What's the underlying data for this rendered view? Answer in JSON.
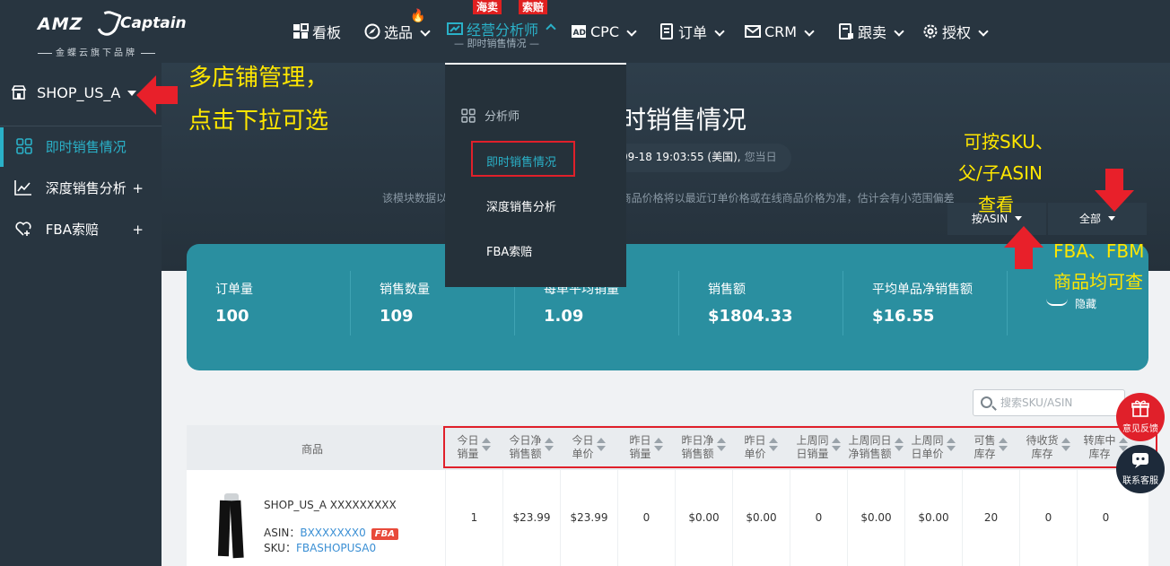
{
  "brand": {
    "logo_left": "AMZ",
    "logo_right": "Captain",
    "tagline": "金蝶云旗下品牌"
  },
  "nav": {
    "items": [
      {
        "label": "看板"
      },
      {
        "label": "选品"
      },
      {
        "label": "经营分析师",
        "sub": "— 即时销售情况 —"
      },
      {
        "label": "CPC"
      },
      {
        "label": "订单"
      },
      {
        "label": "CRM"
      },
      {
        "label": "跟卖"
      },
      {
        "label": "授权"
      }
    ],
    "tag_haimai": "海卖",
    "tag_suopei": "索赔"
  },
  "sidebar": {
    "shop": "SHOP_US_A",
    "items": [
      {
        "label": "即时销售情况"
      },
      {
        "label": "深度销售分析",
        "plus": "+"
      },
      {
        "label": "FBA索赔",
        "plus": "+"
      }
    ]
  },
  "dropdown": {
    "header": "分析师",
    "items": [
      {
        "label": "即时销售情况"
      },
      {
        "label": "深度销售分析"
      },
      {
        "label": "FBA索赔"
      }
    ]
  },
  "hero": {
    "title": "时销售情况",
    "time": "09-18 19:03:55 (美国),",
    "time_suffix": "您当日",
    "note_left": "该模块数据以",
    "note_right": "商品价格将以最近订单价格或在线商品价格为准，估计会有小范围偏差",
    "filter_asin": "按ASIN",
    "filter_all": "全部"
  },
  "stats": [
    {
      "label": "订单量",
      "value": "100"
    },
    {
      "label": "销售数量",
      "value": "109"
    },
    {
      "label": "每单平均销量",
      "value": "1.09"
    },
    {
      "label": "销售额",
      "value": "$1804.33"
    },
    {
      "label": "平均单品净销售额",
      "value": "$16.55"
    }
  ],
  "hide_label": "隐藏",
  "search": {
    "placeholder": "搜索SKU/ASIN"
  },
  "table": {
    "product_header": "商品",
    "columns": [
      {
        "l1": "今日",
        "l2": "销量"
      },
      {
        "l1": "今日净",
        "l2": "销售额"
      },
      {
        "l1": "今日",
        "l2": "单价"
      },
      {
        "l1": "昨日",
        "l2": "销量"
      },
      {
        "l1": "昨日净",
        "l2": "销售额"
      },
      {
        "l1": "昨日",
        "l2": "单价"
      },
      {
        "l1": "上周同",
        "l2": "日销量"
      },
      {
        "l1": "上周同日",
        "l2": "净销售额"
      },
      {
        "l1": "上周同",
        "l2": "日单价"
      },
      {
        "l1": "可售",
        "l2": "库存"
      },
      {
        "l1": "待收货",
        "l2": "库存"
      },
      {
        "l1": "转库中",
        "l2": "库存"
      }
    ],
    "row": {
      "name": "SHOP_US_A  XXXXXXXXX",
      "asin_label": "ASIN：",
      "asin": "BXXXXXXX0",
      "fba": "FBA",
      "sku_label": "SKU：",
      "sku": "FBASHOPUSA0",
      "values": [
        "1",
        "$23.99",
        "$23.99",
        "0",
        "$0.00",
        "$0.00",
        "0",
        "$0.00",
        "$0.00",
        "20",
        "0",
        "0"
      ]
    }
  },
  "annotations": {
    "multi_shop_1": "多店铺管理，",
    "multi_shop_2": "点击下拉可选",
    "sku_1": "可按SKU、",
    "sku_2": "父/子ASIN",
    "sku_3": "查看",
    "fba_1": "FBA、FBM",
    "fba_2": "商品均可查"
  },
  "floats": {
    "feedback": "意见反馈",
    "service": "联系客服"
  }
}
